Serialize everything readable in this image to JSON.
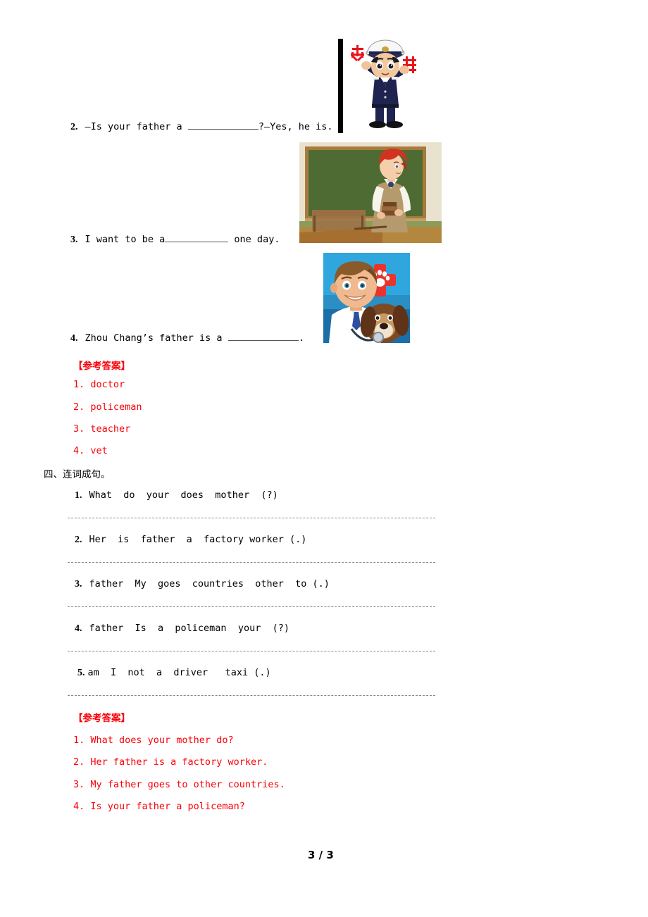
{
  "page": {
    "footer": "3 / 3"
  },
  "section_three": {
    "items": [
      {
        "num": "2.",
        "before": "–Is your father a ",
        "after": "?–Yes, he is.",
        "blank_width": 100
      },
      {
        "num": "3.",
        "before": "I want to be a",
        "after": " one day.",
        "blank_width": 90
      },
      {
        "num": "4.",
        "before": "Zhou Chang’s father is a ",
        "after": ".",
        "blank_width": 100
      }
    ],
    "images": [
      {
        "name": "policeman-illustration",
        "alt": "Cartoon traffic policeman in navy uniform and white cap holding red Chinese characters",
        "colors": {
          "uniform": "#1e2350",
          "cap": "#f2f2f2",
          "skin": "#f0c49a",
          "characters": "#e8151b"
        }
      },
      {
        "name": "teacher-illustration",
        "alt": "Red-haired teacher in tan vest standing beside a green chalkboard holding books",
        "colors": {
          "chalkboard": "#4e6b34",
          "frame": "#a87b3c",
          "wall": "#e9e2cf",
          "hair": "#d2331f",
          "vest": "#b49a6c",
          "desk": "#8a6038"
        }
      },
      {
        "name": "vet-illustration",
        "alt": "Smiling male veterinarian in white coat holding a beagle, red cross with white paw print",
        "colors": {
          "background": "#2fa7de",
          "background_dark": "#1b6fa8",
          "cross": "#e8342c",
          "coat": "#ffffff",
          "skin": "#f0b98f",
          "hair": "#8a5a2b",
          "dog": "#7d4a26",
          "tie": "#2d4fa0"
        }
      }
    ],
    "answer_header": "【参考答案】",
    "answers": [
      "1. doctor",
      "2. policeman",
      "3. teacher",
      "4. vet"
    ]
  },
  "section_four": {
    "heading": "四、连词成句。",
    "items": [
      {
        "num": "1.",
        "text": "What  do  your  does  mother  (?)"
      },
      {
        "num": "2.",
        "text": "Her  is  father  a  factory worker (.)"
      },
      {
        "num": "3.",
        "text": "father  My  goes  countries  other  to (.)"
      },
      {
        "num": "4.",
        "text": "father  Is  a  policeman  your  (?)"
      },
      {
        "num": "5.",
        "text": "am  I  not  a  driver   taxi (.)"
      }
    ],
    "answer_header": "【参考答案】",
    "answers": [
      "1. What does your mother do?",
      "2. Her father is a factory worker.",
      "3. My father goes to other countries.",
      "4. Is your father a policeman?"
    ]
  },
  "colors": {
    "answer_red": "#fb0007",
    "rule_gray": "#8d8295",
    "text_black": "#000000"
  }
}
